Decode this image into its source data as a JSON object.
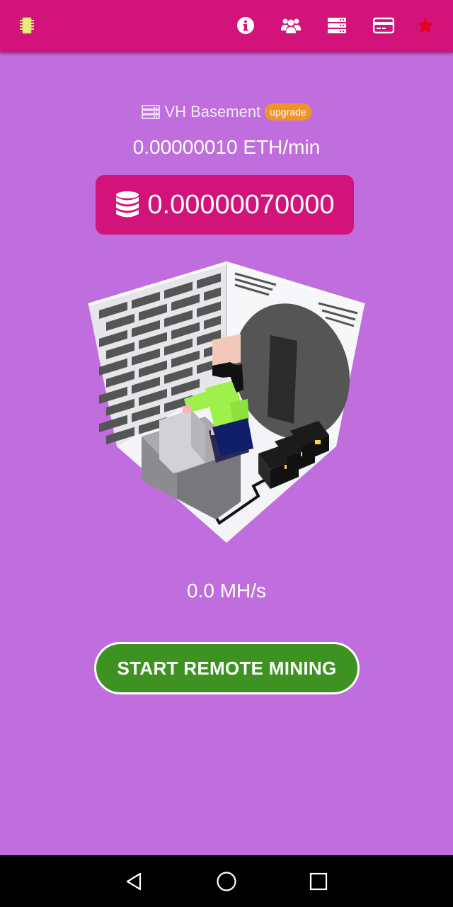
{
  "toolbar": {
    "icons": [
      "chip-icon",
      "info-icon",
      "group-icon",
      "server-icon",
      "credit-card-icon",
      "star-icon"
    ]
  },
  "location": {
    "icon": "server-icon",
    "name": "VH Basement",
    "badge": "upgrade"
  },
  "mining": {
    "rate": "0.00000010 ETH/min",
    "balance": "0.00000070000",
    "balance_icon": "database-icon",
    "hashrate": "0.0 MH/s"
  },
  "actions": {
    "start_label": "START REMOTE MINING"
  },
  "colors": {
    "background": "#c06ddd",
    "appbar": "#d1137a",
    "badge": "#f0932b",
    "start_button": "#3d9221",
    "star": "#e8001c"
  },
  "nav": {
    "icons": [
      "back-icon",
      "home-icon",
      "recents-icon"
    ]
  }
}
